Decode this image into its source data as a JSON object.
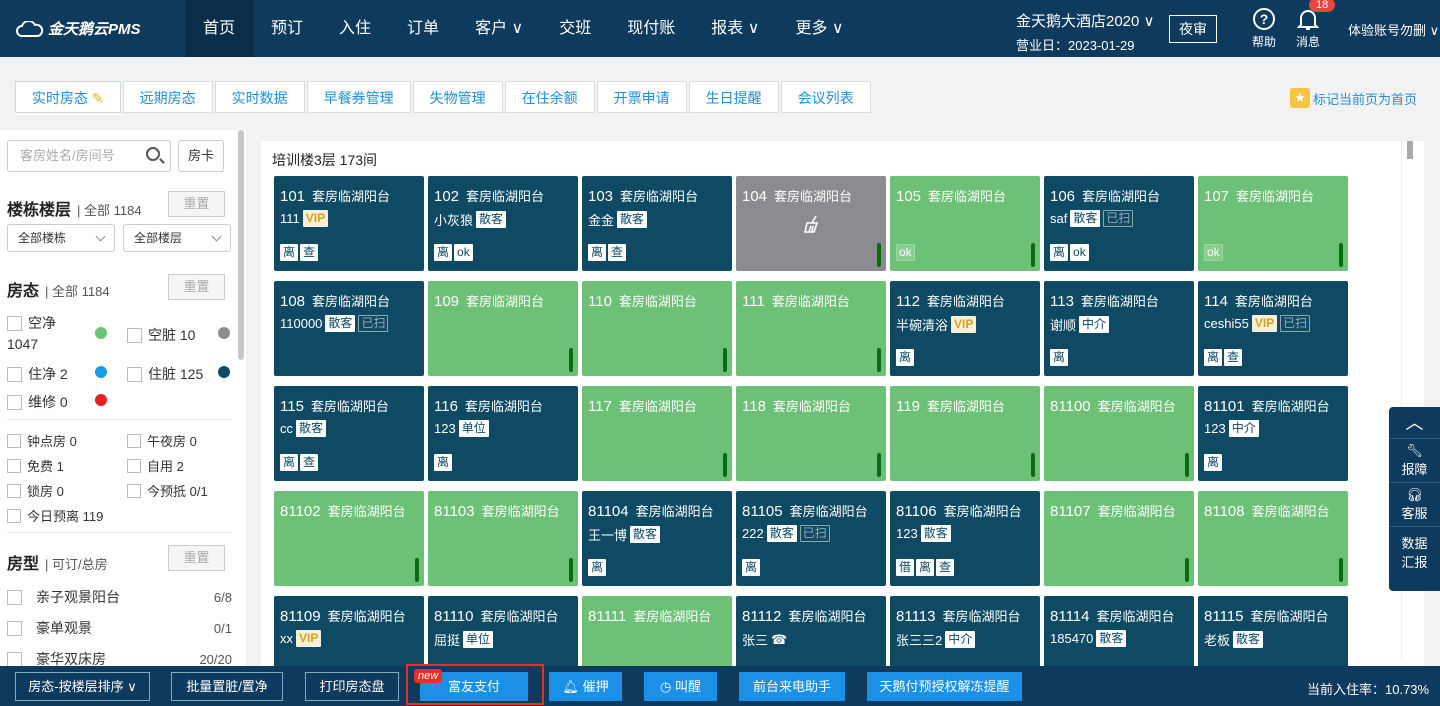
{
  "brand": "金天鹅云PMS",
  "nav": [
    "首页",
    "预订",
    "入住",
    "订单",
    "客户 ∨",
    "交班",
    "现付账",
    "报表 ∨",
    "更多 ∨"
  ],
  "hotel": {
    "name": "金天鹅大酒店2020 ∨",
    "business_day": "营业日：2023-01-29"
  },
  "night_audit": "夜审",
  "help": "帮助",
  "messages": {
    "label": "消息",
    "count": "18"
  },
  "account": "体验账号勿删 ∨",
  "tabs": [
    "实时房态",
    "远期房态",
    "实时数据",
    "早餐券管理",
    "失物管理",
    "在住余额",
    "开票申请",
    "生日提醒",
    "会议列表"
  ],
  "mark_home": "标记当前页为首页",
  "sidebar": {
    "search_placeholder": "客房姓名/房间号",
    "room_card": "房卡",
    "building": {
      "title": "楼栋楼层",
      "sub": "全部 1184",
      "reset": "重置",
      "dd1": "全部楼栋",
      "dd2": "全部楼层"
    },
    "status": {
      "title": "房态",
      "sub": "全部 1184",
      "reset": "重置",
      "items": [
        "空净",
        "1047",
        "空脏 10",
        "住净 2",
        "住脏 125",
        "维修 0"
      ],
      "colors": {
        "vacant_clean": "#6cc176",
        "vacant_dirty": "#8c8b8f",
        "occ_clean": "#1a9be6",
        "occ_dirty": "#0e4a64",
        "repair": "#e82020"
      }
    },
    "flags": [
      "钟点房 0",
      "午夜房 0",
      "免费 1",
      "自用 2",
      "锁房 0",
      "今预抵 0/1",
      "今日预离 119"
    ],
    "roomtype": {
      "title": "房型",
      "sub": "可订/总房",
      "reset": "重置",
      "items": [
        {
          "name": "亲子观景阳台",
          "cnt": "6/8"
        },
        {
          "name": "豪单观景",
          "cnt": "0/1"
        },
        {
          "name": "豪华双床房",
          "cnt": "20/20"
        }
      ]
    }
  },
  "floor_title": "培训楼3层 173间",
  "rooms": [
    {
      "num": "101",
      "type": "套房临湖阳台",
      "style": "dark",
      "guest": "111",
      "tags": [
        "VIP"
      ],
      "bottom": [
        "离",
        "查"
      ]
    },
    {
      "num": "102",
      "type": "套房临湖阳台",
      "style": "dark",
      "guest": "小灰狼",
      "tags": [
        "散客"
      ],
      "bottom": [
        "离",
        "ok"
      ]
    },
    {
      "num": "103",
      "type": "套房临湖阳台",
      "style": "dark",
      "guest": "金金",
      "tags": [
        "散客"
      ],
      "bottom": [
        "离",
        "查"
      ]
    },
    {
      "num": "104",
      "type": "套房临湖阳台",
      "style": "gray",
      "guest": "",
      "tags": [],
      "bottom": [],
      "bar": true,
      "broom": true
    },
    {
      "num": "105",
      "type": "套房临湖阳台",
      "style": "green",
      "guest": "",
      "tags": [],
      "bottom": [
        "ok"
      ],
      "bar": true
    },
    {
      "num": "106",
      "type": "套房临湖阳台",
      "style": "dark",
      "guest": "saf",
      "tags": [
        "散客",
        "已扫"
      ],
      "bottom": [
        "离",
        "ok"
      ]
    },
    {
      "num": "107",
      "type": "套房临湖阳台",
      "style": "green",
      "guest": "",
      "tags": [],
      "bottom": [
        "ok"
      ],
      "bar": true
    },
    {
      "num": "108",
      "type": "套房临湖阳台",
      "style": "dark",
      "guest": "110000",
      "tags": [
        "散客",
        "已扫"
      ],
      "bottom": []
    },
    {
      "num": "109",
      "type": "套房临湖阳台",
      "style": "green",
      "guest": "",
      "tags": [],
      "bottom": [],
      "bar": true
    },
    {
      "num": "110",
      "type": "套房临湖阳台",
      "style": "green",
      "guest": "",
      "tags": [],
      "bottom": [],
      "bar": true
    },
    {
      "num": "111",
      "type": "套房临湖阳台",
      "style": "green",
      "guest": "",
      "tags": [],
      "bottom": [],
      "bar": true
    },
    {
      "num": "112",
      "type": "套房临湖阳台",
      "style": "dark",
      "guest": "半碗清浴",
      "tags": [
        "VIP"
      ],
      "bottom": [
        "离"
      ]
    },
    {
      "num": "113",
      "type": "套房临湖阳台",
      "style": "dark",
      "guest": "谢顺",
      "tags": [
        "中介"
      ],
      "bottom": [
        "离"
      ]
    },
    {
      "num": "114",
      "type": "套房临湖阳台",
      "style": "dark",
      "guest": "ceshi55",
      "tags": [
        "VIP",
        "已扫"
      ],
      "bottom": [
        "离",
        "查"
      ]
    },
    {
      "num": "115",
      "type": "套房临湖阳台",
      "style": "dark",
      "guest": "cc",
      "tags": [
        "散客"
      ],
      "bottom": [
        "离",
        "查"
      ]
    },
    {
      "num": "116",
      "type": "套房临湖阳台",
      "style": "dark",
      "guest": "123",
      "tags": [
        "单位"
      ],
      "bottom": [
        "离"
      ]
    },
    {
      "num": "117",
      "type": "套房临湖阳台",
      "style": "green",
      "guest": "",
      "tags": [],
      "bottom": [],
      "bar": true
    },
    {
      "num": "118",
      "type": "套房临湖阳台",
      "style": "green",
      "guest": "",
      "tags": [],
      "bottom": [],
      "bar": true
    },
    {
      "num": "119",
      "type": "套房临湖阳台",
      "style": "green",
      "guest": "",
      "tags": [],
      "bottom": [],
      "bar": true
    },
    {
      "num": "81100",
      "type": "套房临湖阳台",
      "style": "green",
      "guest": "",
      "tags": [],
      "bottom": [],
      "bar": true
    },
    {
      "num": "81101",
      "type": "套房临湖阳台",
      "style": "dark",
      "guest": "123",
      "tags": [
        "中介"
      ],
      "bottom": [
        "离"
      ]
    },
    {
      "num": "81102",
      "type": "套房临湖阳台",
      "style": "green",
      "guest": "",
      "tags": [],
      "bottom": [],
      "bar": true
    },
    {
      "num": "81103",
      "type": "套房临湖阳台",
      "style": "green",
      "guest": "",
      "tags": [],
      "bottom": [],
      "bar": true
    },
    {
      "num": "81104",
      "type": "套房临湖阳台",
      "style": "dark",
      "guest": "王一博",
      "tags": [
        "散客"
      ],
      "bottom": [
        "离"
      ]
    },
    {
      "num": "81105",
      "type": "套房临湖阳台",
      "style": "dark",
      "guest": "222",
      "tags": [
        "散客",
        "已扫"
      ],
      "bottom": [
        "离"
      ]
    },
    {
      "num": "81106",
      "type": "套房临湖阳台",
      "style": "dark",
      "guest": "123",
      "tags": [
        "散客"
      ],
      "bottom": [
        "借",
        "离",
        "查"
      ]
    },
    {
      "num": "81107",
      "type": "套房临湖阳台",
      "style": "green",
      "guest": "",
      "tags": [],
      "bottom": [],
      "bar": true
    },
    {
      "num": "81108",
      "type": "套房临湖阳台",
      "style": "green",
      "guest": "",
      "tags": [],
      "bottom": [],
      "bar": true
    },
    {
      "num": "81109",
      "type": "套房临湖阳台",
      "style": "dark",
      "guest": "xx",
      "tags": [
        "VIP"
      ],
      "bottom": []
    },
    {
      "num": "81110",
      "type": "套房临湖阳台",
      "style": "dark",
      "guest": "屈挺",
      "tags": [
        "单位"
      ],
      "bottom": []
    },
    {
      "num": "81111",
      "type": "套房临湖阳台",
      "style": "green",
      "guest": "",
      "tags": [],
      "bottom": []
    },
    {
      "num": "81112",
      "type": "套房临湖阳台",
      "style": "dark",
      "guest": "张三",
      "tags": [],
      "bottom": []
    },
    {
      "num": "81113",
      "type": "套房临湖阳台",
      "style": "dark",
      "guest": "张三三2",
      "tags": [
        "中介"
      ],
      "bottom": []
    },
    {
      "num": "81114",
      "type": "套房临湖阳台",
      "style": "dark",
      "guest": "185470",
      "tags": [
        "散客"
      ],
      "bottom": []
    },
    {
      "num": "81115",
      "type": "套房临湖阳台",
      "style": "dark",
      "guest": "老板",
      "tags": [
        "散客"
      ],
      "bottom": []
    }
  ],
  "side_tools": [
    "报障",
    "客服",
    "数据\n汇报"
  ],
  "bottom": {
    "sort": "房态-按楼层排序 ∨",
    "batch": "批量置脏/置净",
    "print": "打印房态盘",
    "pay": "富友支付",
    "new": "new",
    "deposit": "催押",
    "wake": "叫醒",
    "assistant": "前台来电助手",
    "unfreeze": "天鹅付预授权解冻提醒",
    "occupancy": "当前入住率：10.73%"
  }
}
